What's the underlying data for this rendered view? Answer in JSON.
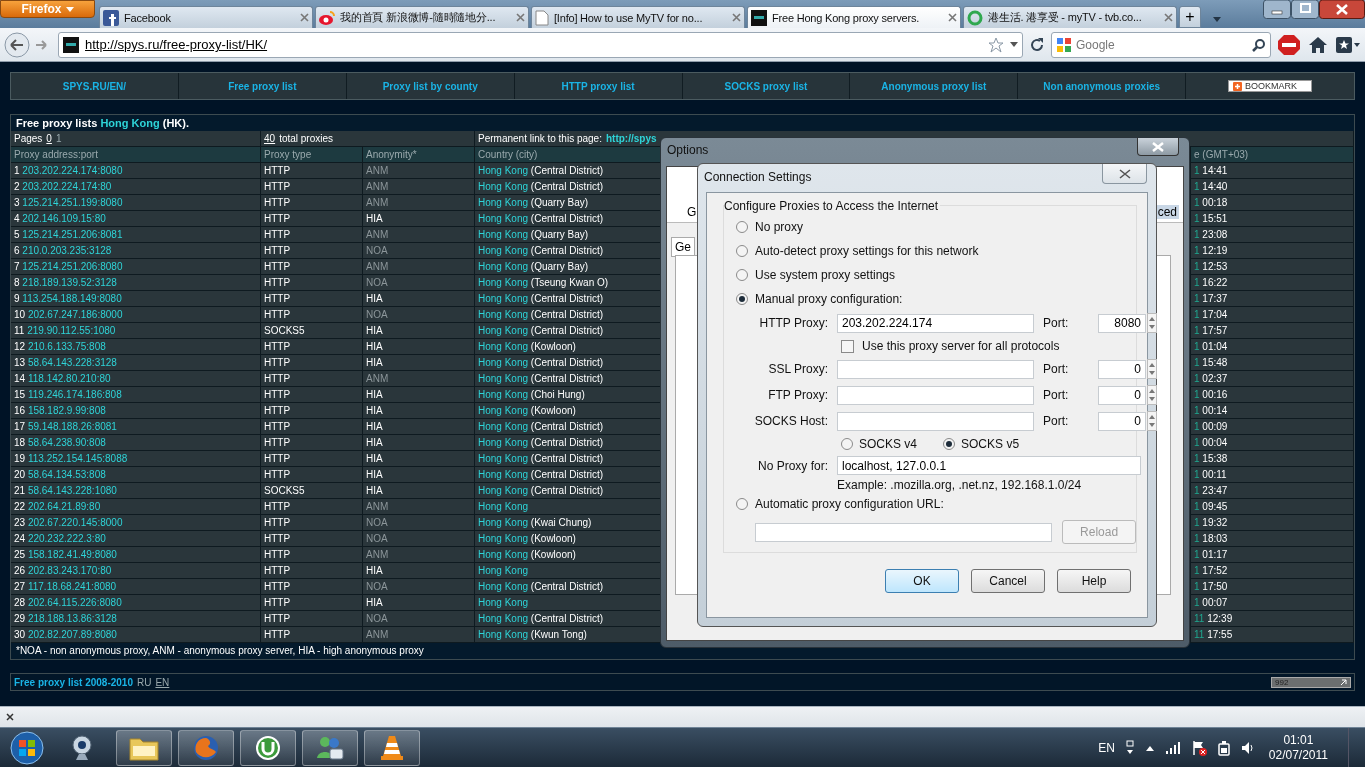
{
  "browser": {
    "app_button": "Firefox",
    "tabs": [
      {
        "title": "Facebook",
        "kind": "fb",
        "selected": false
      },
      {
        "title": "我的首頁 新浪微博-隨時隨地分...",
        "kind": "eye",
        "selected": false
      },
      {
        "title": "[Info] How to use MyTV for no...",
        "kind": "doc",
        "selected": false
      },
      {
        "title": "Free Hong Kong proxy servers.",
        "kind": "dark",
        "selected": true
      },
      {
        "title": "港生活. 港享受 - myTV - tvb.co...",
        "kind": "ring",
        "selected": false
      }
    ],
    "new_tab": "+",
    "url": "http://spys.ru/free-proxy-list/HK/",
    "search_placeholder": "Google"
  },
  "site_menu": [
    {
      "label": "SPYS.RU/EN/"
    },
    {
      "label": "Free proxy list"
    },
    {
      "label": "Proxy list by county"
    },
    {
      "label": "HTTP proxy list"
    },
    {
      "label": "SOCKS proxy list"
    },
    {
      "label": "Anonymous proxy list"
    },
    {
      "label": "Non anonymous proxies"
    }
  ],
  "bookmark_button": "BOOKMARK",
  "proxy_table": {
    "title_prefix": "Free proxy lists",
    "title_link": "Hong Kong",
    "title_suffix": "(HK).",
    "pages_label": "Pages",
    "pages": [
      {
        "label": "0",
        "selected": true
      },
      {
        "label": "1",
        "selected": false
      }
    ],
    "total_count": "40",
    "total_label": "total proxies",
    "permalink_label": "Permanent link to this page:",
    "permalink": "http://spys",
    "columns": [
      "Proxy address:port",
      "Proxy type",
      "Anonymity*",
      "Country (city)",
      "e (GMT+03)"
    ],
    "rows": [
      {
        "n": "1",
        "address": "203.202.224.174:8080",
        "type": "HTTP",
        "anonymity": "ANM",
        "dimmed": true,
        "country": "Hong Kong",
        "city": "(Central District)",
        "date_part": "1",
        "time": "14:41"
      },
      {
        "n": "2",
        "address": "203.202.224.174:80",
        "type": "HTTP",
        "anonymity": "ANM",
        "dimmed": true,
        "country": "Hong Kong",
        "city": "(Central District)",
        "date_part": "1",
        "time": "14:40"
      },
      {
        "n": "3",
        "address": "125.214.251.199:8080",
        "type": "HTTP",
        "anonymity": "ANM",
        "dimmed": true,
        "country": "Hong Kong",
        "city": "(Quarry Bay)",
        "date_part": "1",
        "time": "00:18"
      },
      {
        "n": "4",
        "address": "202.146.109.15:80",
        "type": "HTTP",
        "anonymity": "HIA",
        "dimmed": false,
        "country": "Hong Kong",
        "city": "(Central District)",
        "date_part": "1",
        "time": "15:51"
      },
      {
        "n": "5",
        "address": "125.214.251.206:8081",
        "type": "HTTP",
        "anonymity": "ANM",
        "dimmed": true,
        "country": "Hong Kong",
        "city": "(Quarry Bay)",
        "date_part": "1",
        "time": "23:08"
      },
      {
        "n": "6",
        "address": "210.0.203.235:3128",
        "type": "HTTP",
        "anonymity": "NOA",
        "dimmed": true,
        "country": "Hong Kong",
        "city": "(Central District)",
        "date_part": "1",
        "time": "12:19"
      },
      {
        "n": "7",
        "address": "125.214.251.206:8080",
        "type": "HTTP",
        "anonymity": "ANM",
        "dimmed": true,
        "country": "Hong Kong",
        "city": "(Quarry Bay)",
        "date_part": "1",
        "time": "12:53"
      },
      {
        "n": "8",
        "address": "218.189.139.52:3128",
        "type": "HTTP",
        "anonymity": "NOA",
        "dimmed": true,
        "country": "Hong Kong",
        "city": "(Tseung Kwan O)",
        "date_part": "1",
        "time": "16:22"
      },
      {
        "n": "9",
        "address": "113.254.188.149:8080",
        "type": "HTTP",
        "anonymity": "HIA",
        "dimmed": false,
        "country": "Hong Kong",
        "city": "(Central District)",
        "date_part": "1",
        "time": "17:37"
      },
      {
        "n": "10",
        "address": "202.67.247.186:8000",
        "type": "HTTP",
        "anonymity": "NOA",
        "dimmed": true,
        "country": "Hong Kong",
        "city": "(Central District)",
        "date_part": "1",
        "time": "17:04"
      },
      {
        "n": "11",
        "address": "219.90.112.55:1080",
        "type": "SOCKS5",
        "anonymity": "HIA",
        "dimmed": false,
        "country": "Hong Kong",
        "city": "(Central District)",
        "date_part": "1",
        "time": "17:57"
      },
      {
        "n": "12",
        "address": "210.6.133.75:808",
        "type": "HTTP",
        "anonymity": "HIA",
        "dimmed": false,
        "country": "Hong Kong",
        "city": "(Kowloon)",
        "date_part": "1",
        "time": "01:04"
      },
      {
        "n": "13",
        "address": "58.64.143.228:3128",
        "type": "HTTP",
        "anonymity": "HIA",
        "dimmed": false,
        "country": "Hong Kong",
        "city": "(Central District)",
        "date_part": "1",
        "time": "15:48"
      },
      {
        "n": "14",
        "address": "118.142.80.210:80",
        "type": "HTTP",
        "anonymity": "ANM",
        "dimmed": true,
        "country": "Hong Kong",
        "city": "(Central District)",
        "date_part": "1",
        "time": "02:37"
      },
      {
        "n": "15",
        "address": "119.246.174.186:808",
        "type": "HTTP",
        "anonymity": "HIA",
        "dimmed": false,
        "country": "Hong Kong",
        "city": "(Choi Hung)",
        "date_part": "1",
        "time": "00:16"
      },
      {
        "n": "16",
        "address": "158.182.9.99:808",
        "type": "HTTP",
        "anonymity": "HIA",
        "dimmed": false,
        "country": "Hong Kong",
        "city": "(Kowloon)",
        "date_part": "1",
        "time": "00:14"
      },
      {
        "n": "17",
        "address": "59.148.188.26:8081",
        "type": "HTTP",
        "anonymity": "HIA",
        "dimmed": false,
        "country": "Hong Kong",
        "city": "(Central District)",
        "date_part": "1",
        "time": "00:09"
      },
      {
        "n": "18",
        "address": "58.64.238.90:808",
        "type": "HTTP",
        "anonymity": "HIA",
        "dimmed": false,
        "country": "Hong Kong",
        "city": "(Central District)",
        "date_part": "1",
        "time": "00:04"
      },
      {
        "n": "19",
        "address": "113.252.154.145:8088",
        "type": "HTTP",
        "anonymity": "HIA",
        "dimmed": false,
        "country": "Hong Kong",
        "city": "(Central District)",
        "date_part": "1",
        "time": "15:38"
      },
      {
        "n": "20",
        "address": "58.64.134.53:808",
        "type": "HTTP",
        "anonymity": "HIA",
        "dimmed": false,
        "country": "Hong Kong",
        "city": "(Central District)",
        "date_part": "1",
        "time": "00:11"
      },
      {
        "n": "21",
        "address": "58.64.143.228:1080",
        "type": "SOCKS5",
        "anonymity": "HIA",
        "dimmed": false,
        "country": "Hong Kong",
        "city": "(Central District)",
        "date_part": "1",
        "time": "23:47"
      },
      {
        "n": "22",
        "address": "202.64.21.89:80",
        "type": "HTTP",
        "anonymity": "ANM",
        "dimmed": true,
        "country": "Hong Kong",
        "date_part": "1",
        "time": "09:45"
      },
      {
        "n": "23",
        "address": "202.67.220.145:8000",
        "type": "HTTP",
        "anonymity": "NOA",
        "dimmed": true,
        "country": "Hong Kong",
        "city": "(Kwai Chung)",
        "date_part": "1",
        "time": "19:32"
      },
      {
        "n": "24",
        "address": "220.232.222.3:80",
        "type": "HTTP",
        "anonymity": "NOA",
        "dimmed": true,
        "country": "Hong Kong",
        "city": "(Kowloon)",
        "date_part": "1",
        "time": "18:03"
      },
      {
        "n": "25",
        "address": "158.182.41.49:8080",
        "type": "HTTP",
        "anonymity": "ANM",
        "dimmed": true,
        "country": "Hong Kong",
        "city": "(Kowloon)",
        "date_part": "1",
        "time": "01:17"
      },
      {
        "n": "26",
        "address": "202.83.243.170:80",
        "type": "HTTP",
        "anonymity": "HIA",
        "dimmed": false,
        "country": "Hong Kong",
        "date_part": "1",
        "time": "17:52"
      },
      {
        "n": "27",
        "address": "117.18.68.241:8080",
        "type": "HTTP",
        "anonymity": "NOA",
        "dimmed": true,
        "country": "Hong Kong",
        "city": "(Central District)",
        "date_part": "1",
        "time": "17:50"
      },
      {
        "n": "28",
        "address": "202.64.115.226:8080",
        "type": "HTTP",
        "anonymity": "HIA",
        "dimmed": false,
        "country": "Hong Kong",
        "date_part": "1",
        "time": "00:07"
      },
      {
        "n": "29",
        "address": "218.188.13.86:3128",
        "type": "HTTP",
        "anonymity": "NOA",
        "dimmed": true,
        "country": "Hong Kong",
        "city": "(Central District)",
        "date_part": "11",
        "time": "12:39"
      },
      {
        "n": "30",
        "address": "202.82.207.89:8080",
        "type": "HTTP",
        "anonymity": "ANM",
        "dimmed": true,
        "country": "Hong Kong",
        "city": "(Kwun Tong)",
        "date_part": "11",
        "time": "17:55"
      }
    ],
    "footnote": "*NOA - non anonymous proxy, ANM - anonymous proxy server, HIA - high anonymous proxy"
  },
  "footer": {
    "title": "Free proxy list 2008-2010",
    "languages": [
      {
        "label": "RU",
        "selected": false
      },
      {
        "label": "EN",
        "selected": true
      }
    ],
    "counter": "992"
  },
  "options_window": {
    "title": "Options",
    "toolbar_fragments": [
      "G",
      "ced"
    ],
    "tab_fragment": "Ge"
  },
  "connection_dialog": {
    "title": "Connection Settings",
    "group_title": "Configure Proxies to Access the Internet",
    "modes": [
      {
        "label": "No proxy",
        "kind": "plain",
        "selected": false
      },
      {
        "label": "Auto-detect proxy settings for this network",
        "kind": "plain",
        "selected": false
      },
      {
        "label": "Use system proxy settings",
        "kind": "plain",
        "selected": false
      },
      {
        "label": "Manual proxy configuration:",
        "kind": "manual",
        "selected": true
      },
      {
        "label": "Automatic proxy configuration URL:",
        "kind": "url",
        "selected": false
      }
    ],
    "proxies": [
      {
        "label": "HTTP Proxy:",
        "value": "203.202.224.174",
        "port_label": "Port:",
        "port": "8080"
      },
      {
        "label": "SSL Proxy:",
        "port_label": "Port:",
        "port": "0"
      },
      {
        "label": "FTP Proxy:",
        "port_label": "Port:",
        "port": "0"
      },
      {
        "label": "SOCKS Host:",
        "port_label": "Port:",
        "port": "0"
      }
    ],
    "share_all": {
      "label": "Use this proxy server for all protocols",
      "checked": false
    },
    "socks_versions": [
      {
        "label": "SOCKS v4",
        "selected": false
      },
      {
        "label": "SOCKS v5",
        "selected": true
      }
    ],
    "no_proxy": {
      "label": "No Proxy for:",
      "value": "localhost, 127.0.0.1",
      "example": "Example: .mozilla.org, .net.nz, 192.168.1.0/24"
    },
    "reload": {
      "label": "Reload",
      "disabled": true
    },
    "buttons": [
      {
        "label": "OK",
        "default": true
      },
      {
        "label": "Cancel",
        "default": false
      },
      {
        "label": "Help",
        "default": false
      }
    ]
  },
  "taskbar": {
    "apps": [
      {
        "kind": "webcam"
      },
      {
        "kind": "folder"
      },
      {
        "kind": "globe"
      },
      {
        "kind": "torrent"
      },
      {
        "kind": "people"
      },
      {
        "kind": "cone"
      }
    ],
    "language": "EN",
    "time": "01:01",
    "date": "02/07/2011"
  }
}
